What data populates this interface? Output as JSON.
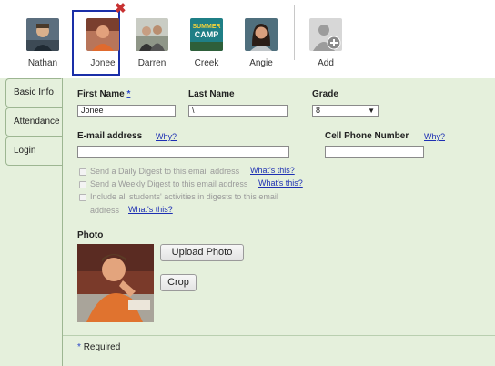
{
  "people": [
    {
      "name": "Nathan"
    },
    {
      "name": "Jonee"
    },
    {
      "name": "Darren"
    },
    {
      "name": "Creek"
    },
    {
      "name": "Angie"
    },
    {
      "name": "Add"
    }
  ],
  "avatar_text": {
    "creek_line1": "SUMMER",
    "creek_line2": "CAMP"
  },
  "remove_symbol": "✖",
  "tabs": [
    "Basic Info",
    "Attendance",
    "Login"
  ],
  "form": {
    "first_name_label": "First Name",
    "required_star": "*",
    "first_name_value": "Jonee",
    "last_name_label": "Last Name",
    "last_name_value": "\\",
    "grade_label": "Grade",
    "grade_value": "8",
    "grade_caret": "▼",
    "email_label": "E-mail address",
    "email_why": "Why?",
    "email_value": "",
    "cell_label": "Cell Phone Number",
    "cell_why": "Why?",
    "cell_value": "",
    "digest_daily": "Send a Daily Digest to this email address",
    "digest_weekly": "Send a Weekly Digest to this email address",
    "digest_include_1": "Include all students' activities in digests to this email",
    "digest_include_2": "address",
    "whats_this": "What's this?",
    "photo_label": "Photo",
    "upload_button": "Upload Photo",
    "crop_button": "Crop",
    "required_note": "Required"
  },
  "colors": {
    "panel_bg": "#e5f0dc",
    "selected_border": "#1a2fa8",
    "link": "#1d2fb3",
    "remove_x": "#c83232"
  }
}
